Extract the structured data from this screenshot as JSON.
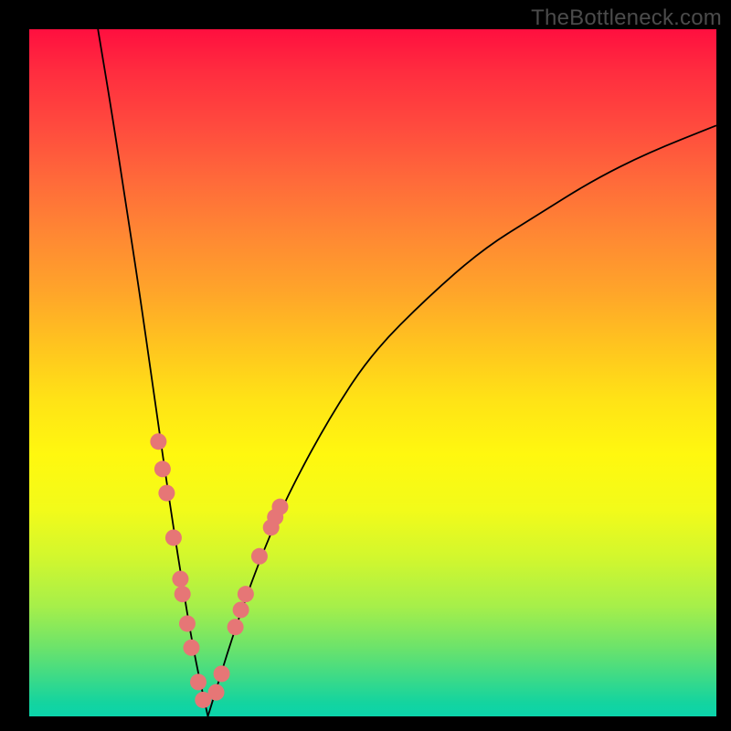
{
  "watermark": "TheBottleneck.com",
  "chart_data": {
    "type": "line",
    "title": "",
    "xlabel": "",
    "ylabel": "",
    "xlim": [
      0,
      100
    ],
    "ylim": [
      0,
      100
    ],
    "notes": "V-shaped bottleneck curve over vertical rainbow gradient. Minimum (valley) near x≈26. Left branch steep, reaches top at x≈10. Right branch shallower, reaches ~y=85 at x=100. Pink beads cluster along lower portion of both branches near valley.",
    "series": [
      {
        "name": "left-branch",
        "x": [
          10,
          12,
          14,
          16,
          18,
          20,
          22,
          24,
          26
        ],
        "y": [
          100,
          88,
          75,
          62,
          48,
          34,
          21,
          9,
          0
        ]
      },
      {
        "name": "right-branch",
        "x": [
          26,
          30,
          34,
          38,
          44,
          50,
          58,
          66,
          74,
          82,
          90,
          100
        ],
        "y": [
          0,
          13,
          24,
          33,
          44,
          53,
          61,
          68,
          73,
          78,
          82,
          86
        ]
      }
    ],
    "beads_left_branch": [
      {
        "x": 18.8,
        "y": 40.0
      },
      {
        "x": 19.4,
        "y": 36.0
      },
      {
        "x": 20.0,
        "y": 32.5
      },
      {
        "x": 21.0,
        "y": 26.0
      },
      {
        "x": 22.0,
        "y": 20.0
      },
      {
        "x": 22.3,
        "y": 17.8
      },
      {
        "x": 23.0,
        "y": 13.5
      },
      {
        "x": 23.6,
        "y": 10.0
      },
      {
        "x": 24.6,
        "y": 5.0
      },
      {
        "x": 25.3,
        "y": 2.4
      }
    ],
    "beads_right_branch": [
      {
        "x": 27.2,
        "y": 3.5
      },
      {
        "x": 28.0,
        "y": 6.2
      },
      {
        "x": 30.0,
        "y": 13.0
      },
      {
        "x": 30.8,
        "y": 15.5
      },
      {
        "x": 31.5,
        "y": 17.8
      },
      {
        "x": 33.5,
        "y": 23.3
      },
      {
        "x": 35.2,
        "y": 27.5
      },
      {
        "x": 35.8,
        "y": 29.0
      },
      {
        "x": 36.5,
        "y": 30.5
      }
    ],
    "bead_radius": 9
  }
}
